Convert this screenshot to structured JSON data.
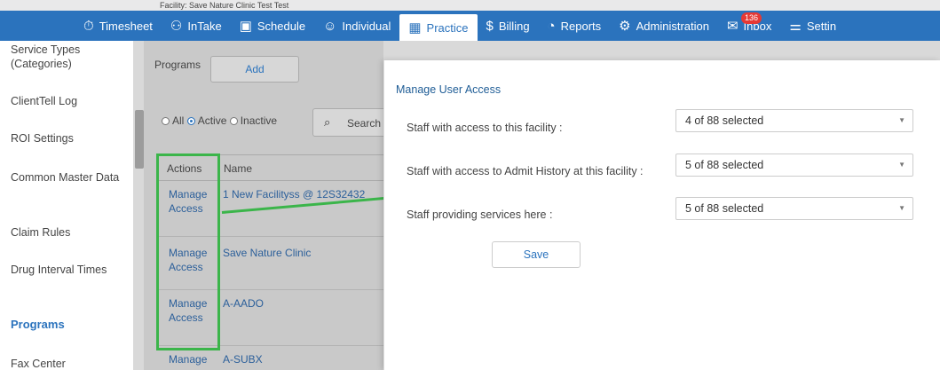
{
  "header": {
    "breadcrumb": "Facility: Save Nature Clinic Test Test",
    "nav": [
      {
        "label": "Timesheet",
        "icon": "clock-plus-icon"
      },
      {
        "label": "InTake",
        "icon": "people-intake-icon"
      },
      {
        "label": "Schedule",
        "icon": "calendar-icon"
      },
      {
        "label": "Individual",
        "icon": "person-icon"
      },
      {
        "label": "Practice",
        "icon": "practice-icon",
        "active": true
      },
      {
        "label": "Billing",
        "icon": "billing-doc-icon"
      },
      {
        "label": "Reports",
        "icon": "pie-chart-icon"
      },
      {
        "label": "Administration",
        "icon": "gear-icon"
      },
      {
        "label": "Inbox",
        "icon": "inbox-icon",
        "badge": "136"
      },
      {
        "label": "Settin",
        "icon": "sliders-icon"
      }
    ]
  },
  "sidebar": {
    "items": [
      {
        "label": "Service Types (Categories)"
      },
      {
        "label": "ClientTell Log"
      },
      {
        "label": "ROI Settings"
      },
      {
        "label": "Common Master Data"
      },
      {
        "label": "Claim Rules"
      },
      {
        "label": "Drug Interval Times"
      },
      {
        "label": "Programs",
        "active": true
      },
      {
        "label": "Fax Center"
      }
    ]
  },
  "main": {
    "programs_label": "Programs",
    "add_label": "Add",
    "filters": [
      "All",
      "Active",
      "Inactive"
    ],
    "selected_filter": "Active",
    "search_placeholder": "Search",
    "columns": [
      "Actions",
      "Name"
    ],
    "rows": [
      {
        "action": "Manage Access",
        "name": "1 New Facilityss @ 12S32432"
      },
      {
        "action": "Manage Access",
        "name": "Save Nature Clinic"
      },
      {
        "action": "Manage Access",
        "name": "A-AADO"
      },
      {
        "action": "Manage",
        "name": "A-SUBX"
      }
    ]
  },
  "modal": {
    "title": "Manage User Access",
    "fields": [
      {
        "label": "Staff with access to this facility :",
        "value": "4 of 88 selected"
      },
      {
        "label": "Staff with access to Admit History at this facility :",
        "value": "5 of 88 selected"
      },
      {
        "label": "Staff providing services here :",
        "value": "5 of 88 selected"
      }
    ],
    "save_label": "Save"
  },
  "colors": {
    "nav_bg": "#2b73bd",
    "annotation_green": "#3bb54a",
    "link": "#2b5f9a"
  }
}
